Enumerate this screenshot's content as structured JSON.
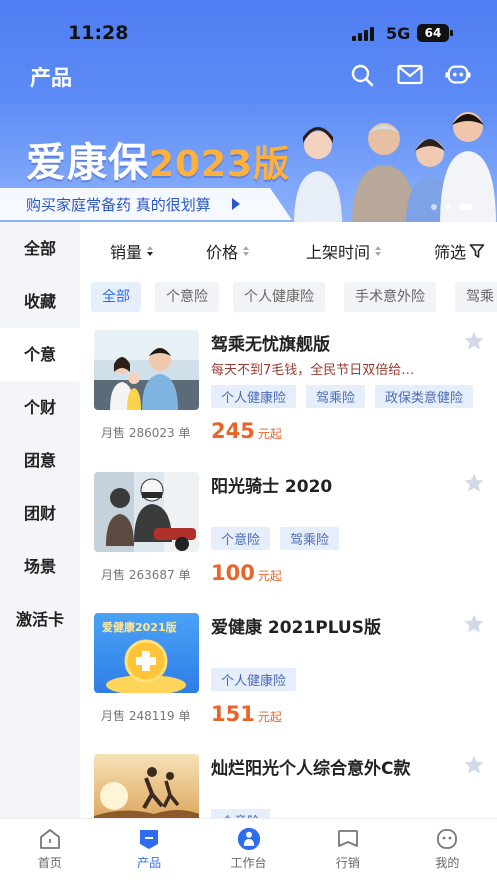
{
  "status_bar": {
    "time": "11:28",
    "network": "5G",
    "battery": "64"
  },
  "header": {
    "title": "产品",
    "icons": [
      "search-icon",
      "mail-icon",
      "robot-icon"
    ]
  },
  "banner": {
    "title_main": "爱康保",
    "title_year": "2023版",
    "subtitle": "购买家庭常备药 真的很划算"
  },
  "sidebar": {
    "items": [
      {
        "label": "全部"
      },
      {
        "label": "收藏"
      },
      {
        "label": "个意"
      },
      {
        "label": "个财"
      },
      {
        "label": "团意"
      },
      {
        "label": "团财"
      },
      {
        "label": "场景"
      },
      {
        "label": "激活卡"
      }
    ],
    "active_index": 2
  },
  "sort_bar": {
    "sales": "销量",
    "price": "价格",
    "time": "上架时间",
    "filter": "筛选"
  },
  "filters": {
    "items": [
      "全部",
      "个意险",
      "个人健康险",
      "手术意外险",
      "驾乘"
    ],
    "active_index": 0
  },
  "products": [
    {
      "name": "驾乘无忧旗舰版",
      "desc": "每天不到7毛钱，全民节日双倍给…",
      "tags": [
        "个人健康险",
        "驾乘险",
        "政保类意健险"
      ],
      "sales": "月售 286023 单",
      "price": "245",
      "unit": "元起"
    },
    {
      "name": "阳光骑士 2020",
      "desc": "",
      "tags": [
        "个意险",
        "驾乘险"
      ],
      "sales": "月售 263687 单",
      "price": "100",
      "unit": "元起"
    },
    {
      "name": "爱健康 2021PLUS版",
      "desc": "",
      "tags": [
        "个人健康险"
      ],
      "sales": "月售 248119 单",
      "price": "151",
      "unit": "元起",
      "thumb_text": "爱健康2021版"
    },
    {
      "name": "灿烂阳光个人综合意外C款",
      "desc": "",
      "tags": [
        "个意险"
      ],
      "sales": "",
      "price": "",
      "unit": ""
    }
  ],
  "tabbar": {
    "items": [
      {
        "label": "首页",
        "icon": "home-icon"
      },
      {
        "label": "产品",
        "icon": "product-icon"
      },
      {
        "label": "工作台",
        "icon": "workbench-icon"
      },
      {
        "label": "行销",
        "icon": "marketing-icon"
      },
      {
        "label": "我的",
        "icon": "profile-icon"
      }
    ],
    "active_index": 1
  },
  "colors": {
    "accent": "#2f6df0",
    "price": "#e8642b",
    "header": "#4f7df2"
  }
}
